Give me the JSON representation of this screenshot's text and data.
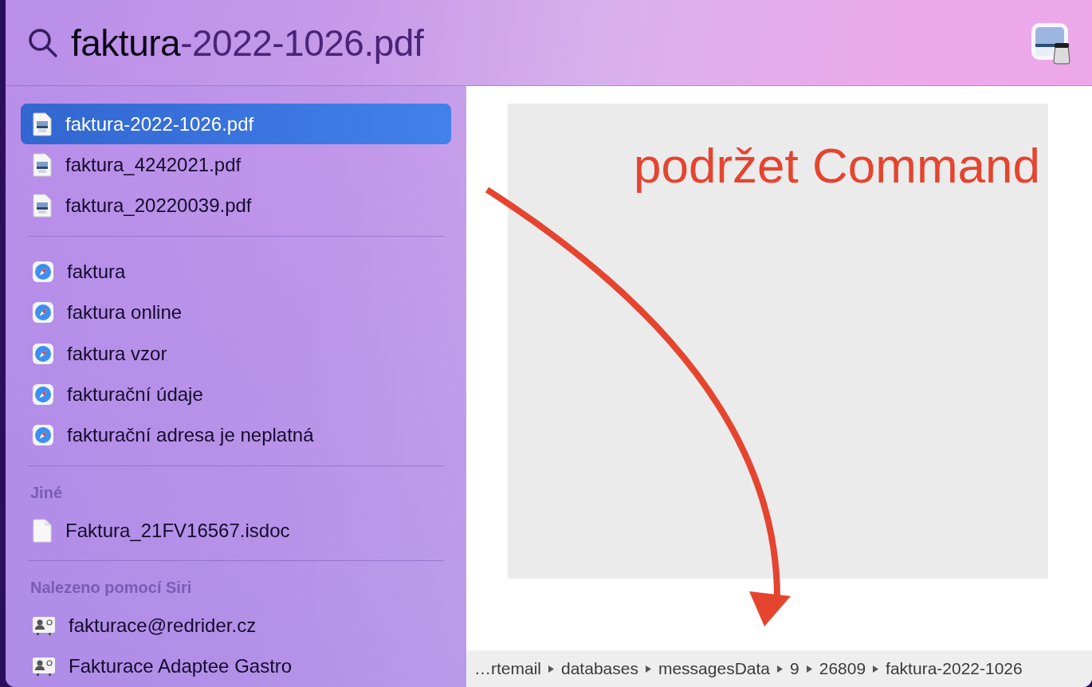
{
  "search": {
    "query": "faktura",
    "completion": "-2022-1026.pdf"
  },
  "sections": [
    {
      "items": [
        {
          "kind": "pdf",
          "label": "faktura-2022-1026.pdf",
          "selected": true
        },
        {
          "kind": "pdf",
          "label": "faktura_4242021.pdf",
          "selected": false
        },
        {
          "kind": "pdf",
          "label": "faktura_20220039.pdf",
          "selected": false
        }
      ]
    },
    {
      "items": [
        {
          "kind": "safari",
          "label": "faktura",
          "selected": false
        },
        {
          "kind": "safari",
          "label": "faktura online",
          "selected": false
        },
        {
          "kind": "safari",
          "label": "faktura vzor",
          "selected": false
        },
        {
          "kind": "safari",
          "label": "fakturační údaje",
          "selected": false
        },
        {
          "kind": "safari",
          "label": "fakturační adresa je neplatná",
          "selected": false
        }
      ]
    },
    {
      "header": "Jiné",
      "items": [
        {
          "kind": "file",
          "label": "Faktura_21FV16567.isdoc",
          "selected": false
        }
      ]
    },
    {
      "header": "Nalezeno pomocí Siri",
      "items": [
        {
          "kind": "contact",
          "label": "fakturace@redrider.cz",
          "selected": false
        },
        {
          "kind": "contact",
          "label": "Fakturace Adaptee Gastro",
          "selected": false
        }
      ]
    }
  ],
  "preview": {
    "annotation": "podržet Command"
  },
  "path": [
    "…rtemail",
    "databases",
    "messagesData",
    "9",
    "26809",
    "faktura-2022-1026"
  ]
}
